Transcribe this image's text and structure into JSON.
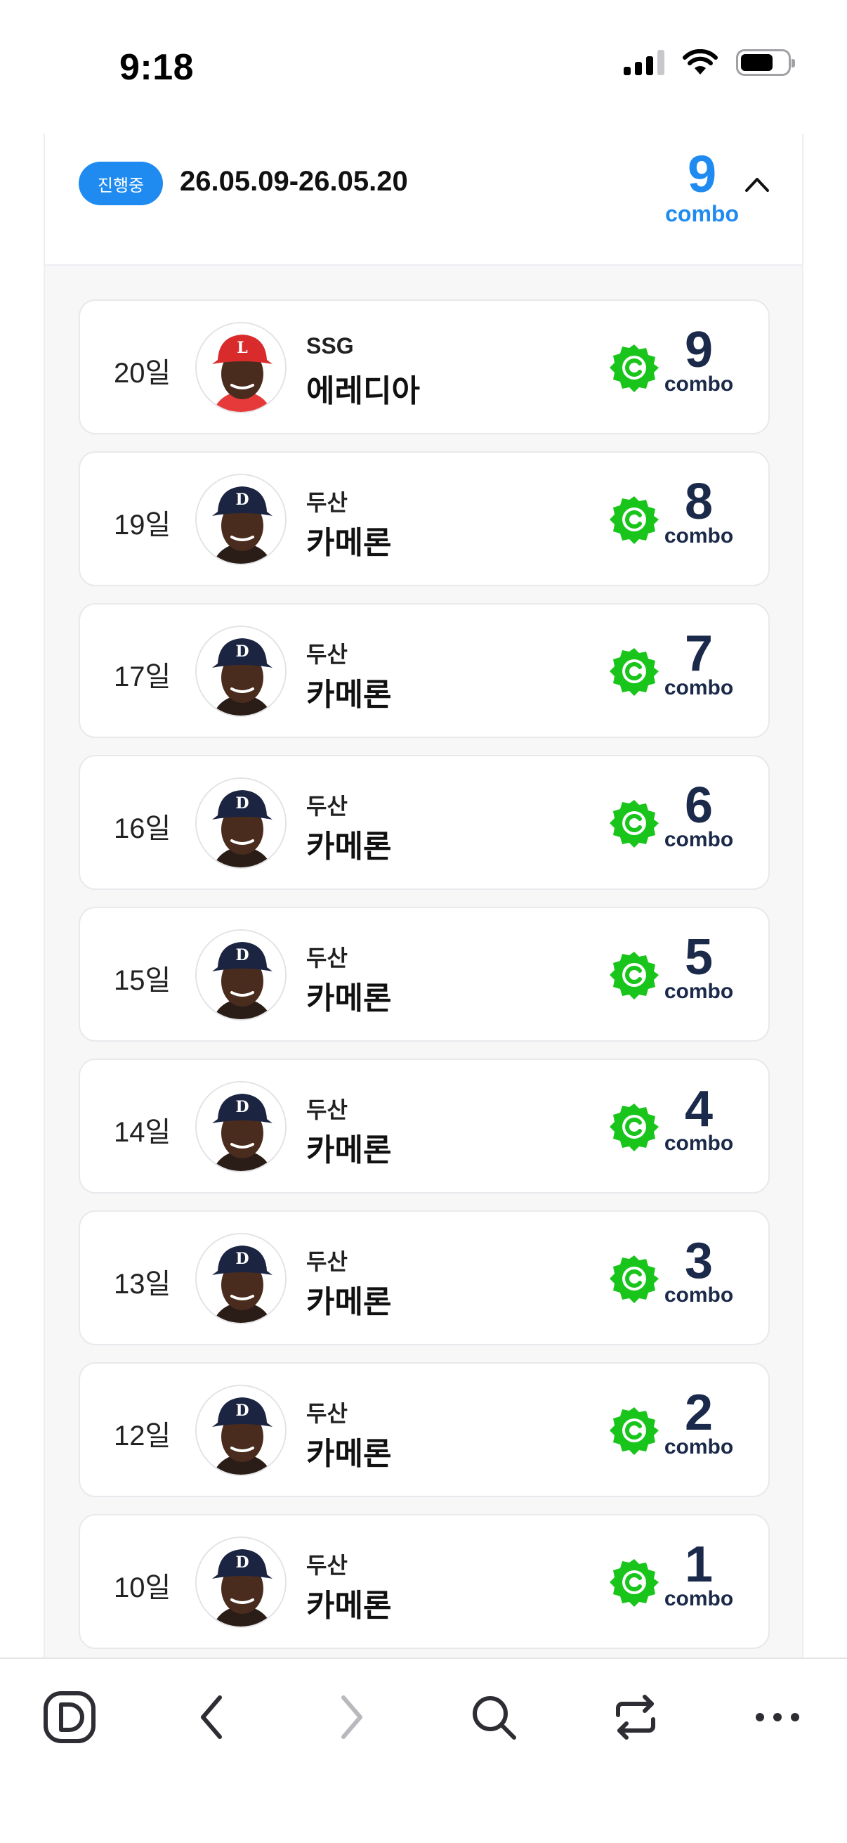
{
  "status_bar": {
    "time": "9:18"
  },
  "header": {
    "status_label": "진행중",
    "date_range": "26.05.09-26.05.20",
    "combo_count": "9",
    "combo_label": "combo",
    "accent_color": "#1f8bf1"
  },
  "entries": [
    {
      "day": "20일",
      "team": "SSG",
      "player": "에레디아",
      "combo": "9",
      "combo_label": "combo",
      "cap": "red"
    },
    {
      "day": "19일",
      "team": "두산",
      "player": "카메론",
      "combo": "8",
      "combo_label": "combo",
      "cap": "navy"
    },
    {
      "day": "17일",
      "team": "두산",
      "player": "카메론",
      "combo": "7",
      "combo_label": "combo",
      "cap": "navy"
    },
    {
      "day": "16일",
      "team": "두산",
      "player": "카메론",
      "combo": "6",
      "combo_label": "combo",
      "cap": "navy"
    },
    {
      "day": "15일",
      "team": "두산",
      "player": "카메론",
      "combo": "5",
      "combo_label": "combo",
      "cap": "navy"
    },
    {
      "day": "14일",
      "team": "두산",
      "player": "카메론",
      "combo": "4",
      "combo_label": "combo",
      "cap": "navy"
    },
    {
      "day": "13일",
      "team": "두산",
      "player": "카메론",
      "combo": "3",
      "combo_label": "combo",
      "cap": "navy"
    },
    {
      "day": "12일",
      "team": "두산",
      "player": "카메론",
      "combo": "2",
      "combo_label": "combo",
      "cap": "navy"
    },
    {
      "day": "10일",
      "team": "두산",
      "player": "카메론",
      "combo": "1",
      "combo_label": "combo",
      "cap": "navy"
    }
  ],
  "badge_color": "#19c51b",
  "toolbar": {
    "icons": [
      "browser-logo-icon",
      "back-arrow-icon",
      "forward-arrow-icon",
      "search-icon",
      "tabs-switch-icon",
      "more-icon"
    ]
  }
}
